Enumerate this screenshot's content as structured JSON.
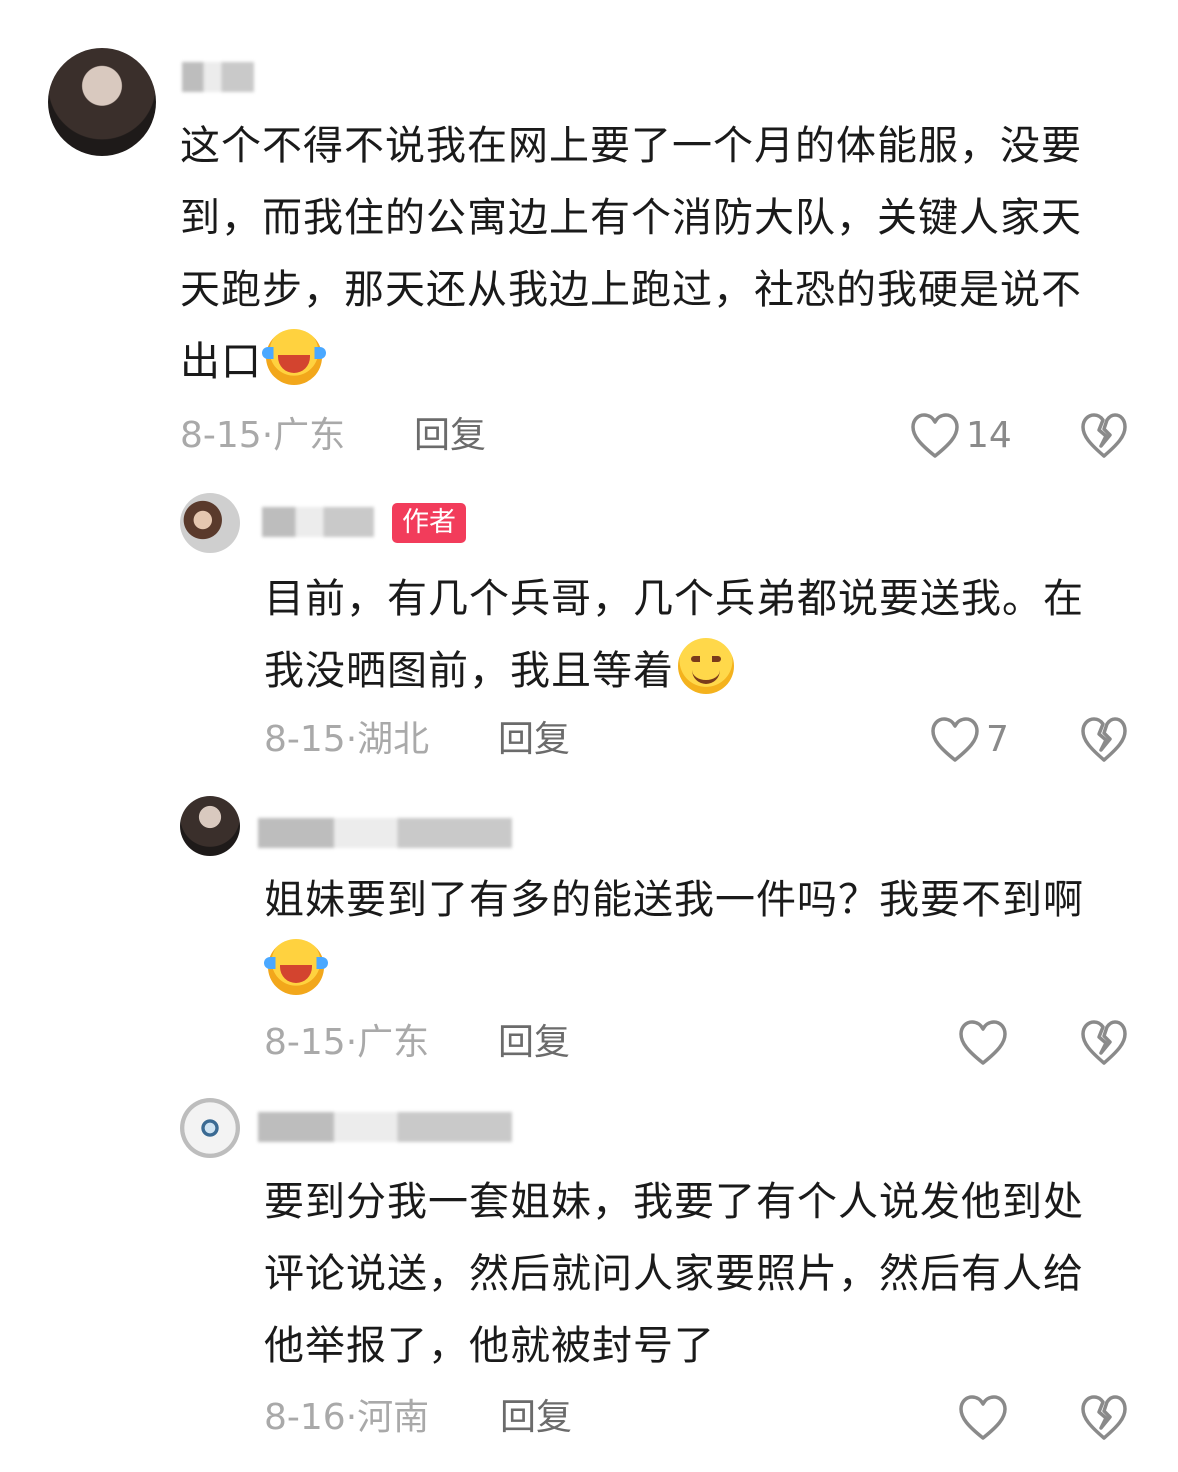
{
  "comments": [
    {
      "text": "这个不得不说我在网上要了一个月的体能服，没要到，而我住的公寓边上有个消防大队，关键人家天天跑步，那天还从我边上跑过，社恐的我硬是说不出口",
      "emoji": "laugh-cry-emoji",
      "date": "8-15",
      "location": "广东",
      "reply_label": "回复",
      "likes": "14"
    },
    {
      "badge": "作者",
      "text": "目前，有几个兵哥，几个兵弟都说要送我。在我没晒图前，我且等着",
      "emoji": "smile-emoji",
      "date": "8-15",
      "location": "湖北",
      "reply_label": "回复",
      "likes": "7"
    },
    {
      "text": "姐妹要到了有多的能送我一件吗？我要不到啊",
      "emoji": "laugh-cry-emoji",
      "date": "8-15",
      "location": "广东",
      "reply_label": "回复",
      "likes": ""
    },
    {
      "text": "要到分我一套姐妹，我要了有个人说发他到处评论说送，然后就问人家要照片，然后有人给他举报了，他就被封号了",
      "date": "8-16",
      "location": "河南",
      "reply_label": "回复",
      "likes": ""
    }
  ],
  "separator": "·",
  "colors": {
    "badge": "#f23c5b",
    "meta": "#a9a9a9",
    "icon": "#8a8a8a"
  }
}
